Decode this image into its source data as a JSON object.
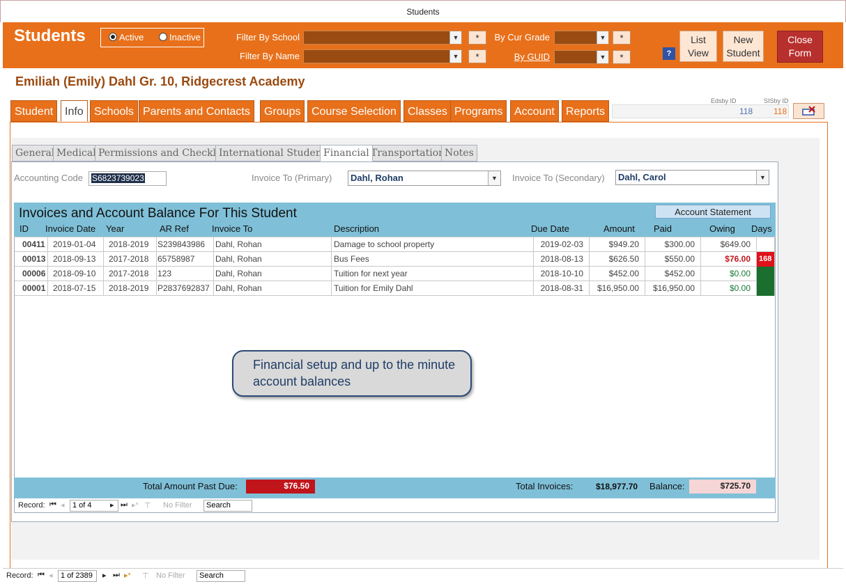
{
  "window": {
    "title": "Students"
  },
  "header": {
    "title": "Students",
    "status_options": [
      {
        "label": "Active",
        "selected": true
      },
      {
        "label": "Inactive",
        "selected": false
      }
    ],
    "filter_school_label": "Filter By School",
    "filter_name_label": "Filter By Name",
    "cur_grade_label": "By Cur Grade",
    "guid_label": "By GUID",
    "star": "*",
    "help": "?",
    "list_view": "List View",
    "new_student": "New Student",
    "close_form": "Close Form"
  },
  "student": {
    "name": "Emiliah (Emily)  Dahl  Gr. 10, Ridgecrest Academy"
  },
  "main_tabs": [
    "Student",
    "Info",
    "Schools",
    "Parents and Contacts",
    "Groups",
    "Course Selection",
    "Classes",
    "Programs",
    "Account",
    "Reports"
  ],
  "ids": {
    "edsby_label": "Edsby ID",
    "edsby_value": "118",
    "sisby_label": "SISby ID",
    "sisby_value": "118"
  },
  "sub_tabs": [
    "General",
    "Medical",
    "Permissions and Checklist",
    "International Students",
    "Financial",
    "Transportation",
    "Notes"
  ],
  "financial": {
    "accounting_code_label": "Accounting Code",
    "accounting_code": "S6823739023",
    "invoice_primary_label": "Invoice To (Primary)",
    "invoice_primary": "Dahl, Rohan",
    "invoice_secondary_label": "Invoice To (Secondary)",
    "invoice_secondary": "Dahl, Carol"
  },
  "invoices": {
    "title": "Invoices and Account Balance For This Student",
    "statement_button": "Account Statement",
    "columns": [
      "ID",
      "Invoice Date",
      "Year",
      "AR Ref",
      "Invoice To",
      "Description",
      "Due Date",
      "Amount",
      "Paid",
      "Owing",
      "Days"
    ],
    "rows": [
      {
        "id": "00411",
        "invoice_date": "2019-01-04",
        "year": "2018-2019",
        "ar_ref": "S239843986",
        "invoice_to": "Dahl, Rohan",
        "description": "Damage to school property",
        "due_date": "2019-02-03",
        "amount": "$949.20",
        "paid": "$300.00",
        "owing": "$649.00",
        "days": "",
        "status": "normal"
      },
      {
        "id": "00013",
        "invoice_date": "2018-09-13",
        "year": "2017-2018",
        "ar_ref": "65758987",
        "invoice_to": "Dahl, Rohan",
        "description": "Bus  Fees",
        "due_date": "2018-08-13",
        "amount": "$626.50",
        "paid": "$550.00",
        "owing": "$76.00",
        "days": "168",
        "status": "overdue"
      },
      {
        "id": "00006",
        "invoice_date": "2018-09-10",
        "year": "2017-2018",
        "ar_ref": "123",
        "invoice_to": "Dahl, Rohan",
        "description": "Tuition for next year",
        "due_date": "2018-10-10",
        "amount": "$452.00",
        "paid": "$452.00",
        "owing": "$0.00",
        "days": "",
        "status": "paid"
      },
      {
        "id": "00001",
        "invoice_date": "2018-07-15",
        "year": "2018-2019",
        "ar_ref": "P2837692837",
        "invoice_to": "Dahl, Rohan",
        "description": "Tuition for Emily Dahl",
        "due_date": "2018-08-31",
        "amount": "$16,950.00",
        "paid": "$16,950.00",
        "owing": "$0.00",
        "days": "",
        "status": "paid"
      }
    ],
    "total_past_due_label": "Total Amount Past Due:",
    "total_past_due": "$76.50",
    "total_invoices_label": "Total Invoices:",
    "total_invoices": "$18,977.70",
    "balance_label": "Balance:",
    "balance": "$725.70",
    "nav": {
      "record_label": "Record:",
      "position": "1 of 4",
      "filter": "No Filter",
      "search": "Search"
    }
  },
  "callout": {
    "text": "Financial setup and up to the minute account balances"
  },
  "bottom_nav": {
    "record_label": "Record:",
    "position": "1 of 2389",
    "filter": "No Filter",
    "search": "Search"
  },
  "colors": {
    "accent": "#e8701a",
    "grid_header": "#7fc0d8",
    "past_due": "#c0151b",
    "paid_green": "#1a7a32"
  }
}
